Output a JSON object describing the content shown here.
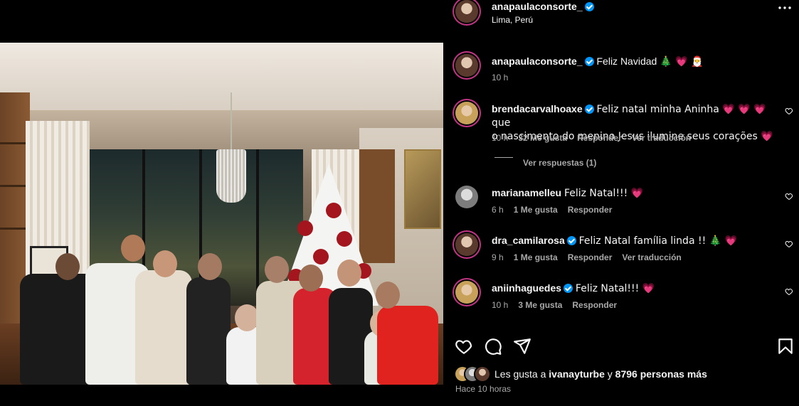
{
  "post": {
    "author": "anapaulaconsorte_",
    "location": "Lima, Perú",
    "more_icon": "more-horizontal-icon"
  },
  "caption": {
    "username": "anapaulaconsorte_",
    "text": "Feliz Navidad",
    "emojis": "🎄 💗 🎅",
    "time": "10 h"
  },
  "comments": [
    {
      "username": "brendacarvalhoaxe",
      "verified": true,
      "text_line1": "Feliz natal minha Aninha 💗 💗 💗 que",
      "text_line2": "o nascimento do menino Jesus ilumine seus corações 💗",
      "time": "10 h",
      "likes": "32 Me gusta",
      "reply": "Responder",
      "translate": "Ver traducción",
      "view_replies": "Ver respuestas (1)"
    },
    {
      "username": "marianamelleu",
      "verified": false,
      "text": "Feliz Natal!!! 💗",
      "time": "6 h",
      "likes": "1 Me gusta",
      "reply": "Responder"
    },
    {
      "username": "dra_camilarosa",
      "verified": true,
      "text": "Feliz Natal família linda !! 🎄 💗",
      "time": "9 h",
      "likes": "1 Me gusta",
      "reply": "Responder",
      "translate": "Ver traducción"
    },
    {
      "username": "aniinhaguedes",
      "verified": true,
      "text": "Feliz Natal!!! 💗",
      "time": "10 h",
      "likes": "3 Me gusta",
      "reply": "Responder"
    }
  ],
  "actions": {
    "like_icon": "heart-icon",
    "comment_icon": "comment-icon",
    "share_icon": "send-icon",
    "save_icon": "bookmark-icon"
  },
  "likes_summary": {
    "prefix": "Les gusta a",
    "user": "ivanayturbe",
    "connector": "y",
    "others": "8796 personas más"
  },
  "posted": "Hace 10 horas",
  "colors": {
    "background": "#000000",
    "text": "#f5f5f5",
    "muted": "#a8a8a8",
    "verified": "#0095f6",
    "heart": "#ff3b7a"
  }
}
